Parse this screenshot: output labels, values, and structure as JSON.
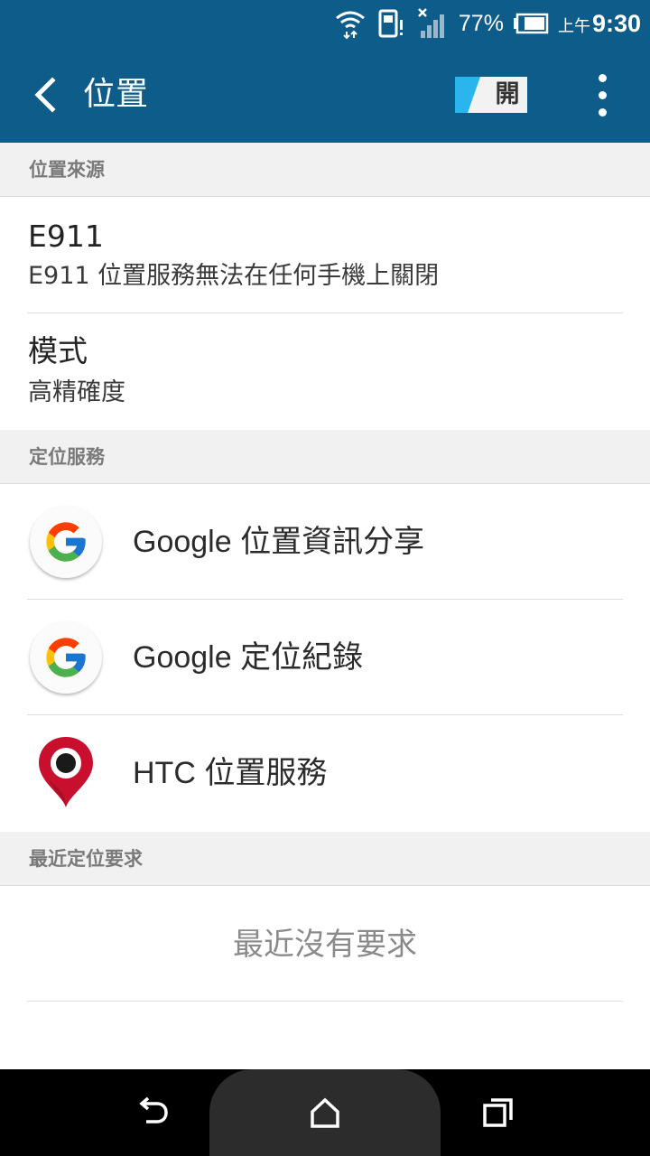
{
  "status_bar": {
    "battery_percent": "77%",
    "ampm": "上午",
    "time": "9:30",
    "icons": [
      "wifi-icon",
      "sim-alert-icon",
      "signal-icon",
      "battery-icon"
    ]
  },
  "app_bar": {
    "title": "位置",
    "toggle_label": "開",
    "toggle_on": true,
    "colors": {
      "bar": "#0e5c8a",
      "toggle_accent": "#2ab5ef"
    }
  },
  "sections": {
    "location_source": "位置來源",
    "location_services": "定位服務",
    "recent_requests": "最近定位要求"
  },
  "location_source": {
    "e911": {
      "title": "E911",
      "subtitle": "E911 位置服務無法在任何手機上關閉"
    },
    "mode": {
      "title": "模式",
      "subtitle": "高精確度"
    }
  },
  "services": [
    {
      "label": "Google 位置資訊分享",
      "icon": "google-icon"
    },
    {
      "label": "Google 定位紀錄",
      "icon": "google-icon"
    },
    {
      "label": "HTC 位置服務",
      "icon": "location-pin-icon"
    }
  ],
  "recent": {
    "empty_text": "最近沒有要求"
  },
  "nav_bar": {
    "icons": [
      "back-icon",
      "home-icon",
      "recents-icon"
    ]
  }
}
